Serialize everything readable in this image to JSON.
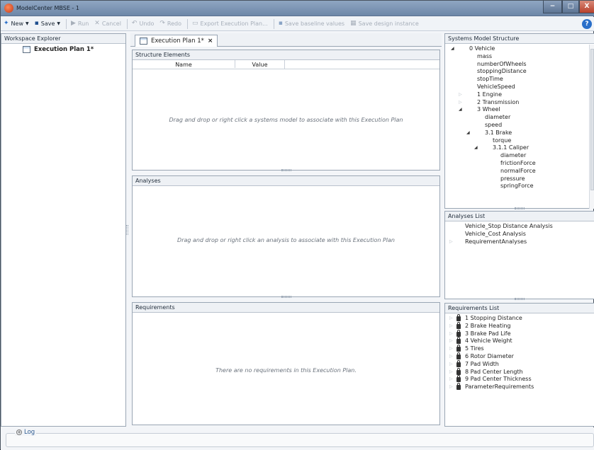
{
  "window": {
    "title": "ModelCenter MBSE - 1",
    "min": "−",
    "max": "□",
    "close": "X"
  },
  "toolbar": {
    "new": "New",
    "save": "Save",
    "run": "Run",
    "cancel": "Cancel",
    "undo": "Undo",
    "redo": "Redo",
    "export": "Export Execution Plan...",
    "save_baseline": "Save baseline values",
    "save_design": "Save design instance",
    "help": "?"
  },
  "explorer": {
    "title": "Workspace Explorer",
    "item": "Execution Plan 1*"
  },
  "tab": {
    "label": "Execution Plan 1*",
    "close": "×"
  },
  "structure": {
    "title": "Structure Elements",
    "col_name": "Name",
    "col_value": "Value",
    "hint": "Drag and drop or right click a systems model to associate with this Execution Plan"
  },
  "analyses": {
    "title": "Analyses",
    "hint": "Drag and drop or right click an analysis to associate with this Execution Plan"
  },
  "requirements": {
    "title": "Requirements",
    "hint": "There are no requirements in this Execution Plan."
  },
  "sysmodel": {
    "title": "Systems Model Structure",
    "items": [
      {
        "label": "0 Vehicle",
        "level": 0,
        "arrow": "open"
      },
      {
        "label": "mass",
        "level": 1,
        "arrow": ""
      },
      {
        "label": "numberOfWheels",
        "level": 1,
        "arrow": ""
      },
      {
        "label": "stoppingDistance",
        "level": 1,
        "arrow": ""
      },
      {
        "label": "stopTime",
        "level": 1,
        "arrow": ""
      },
      {
        "label": "VehicleSpeed",
        "level": 1,
        "arrow": ""
      },
      {
        "label": "1 Engine",
        "level": 1,
        "arrow": "closed"
      },
      {
        "label": "2 Transmission",
        "level": 1,
        "arrow": "closed"
      },
      {
        "label": "3 Wheel",
        "level": 1,
        "arrow": "open"
      },
      {
        "label": "diameter",
        "level": 2,
        "arrow": ""
      },
      {
        "label": "speed",
        "level": 2,
        "arrow": ""
      },
      {
        "label": "3.1 Brake",
        "level": 2,
        "arrow": "open"
      },
      {
        "label": "torque",
        "level": 3,
        "arrow": ""
      },
      {
        "label": "3.1.1 Caliper",
        "level": 3,
        "arrow": "open"
      },
      {
        "label": "diameter",
        "level": 4,
        "arrow": ""
      },
      {
        "label": "frictionForce",
        "level": 4,
        "arrow": ""
      },
      {
        "label": "normalForce",
        "level": 4,
        "arrow": ""
      },
      {
        "label": "pressure",
        "level": 4,
        "arrow": ""
      },
      {
        "label": "springForce",
        "level": 4,
        "arrow": ""
      }
    ]
  },
  "alist": {
    "title": "Analyses List",
    "items": [
      {
        "label": "Vehicle_Stop Distance Analysis",
        "arrow": ""
      },
      {
        "label": "Vehicle_Cost Analysis",
        "arrow": ""
      },
      {
        "label": "RequirementAnalyses",
        "arrow": "closed"
      }
    ]
  },
  "rlist": {
    "title": "Requirements List",
    "items": [
      "1 Stopping Distance",
      "2 Brake Heating",
      "3 Brake Pad Life",
      "4 Vehicle Weight",
      "5 Tires",
      "6 Rotor Diameter",
      "7 Pad Width",
      "8 Pad Center Length",
      "9 Pad Center Thickness",
      "ParameterRequirements"
    ]
  },
  "log": {
    "label": "Log",
    "toggle": "+"
  }
}
